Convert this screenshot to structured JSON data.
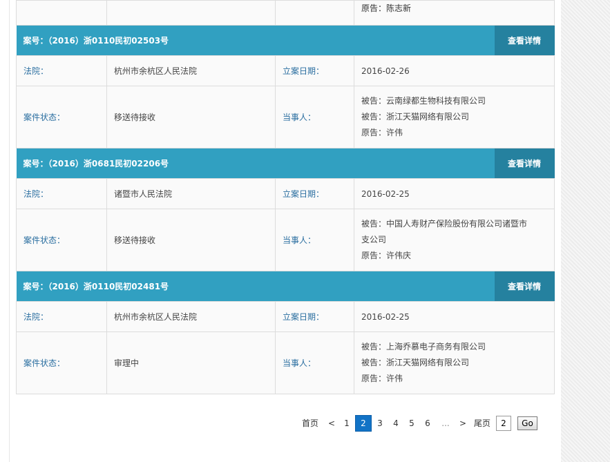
{
  "top_partial": {
    "parties": [
      "原告：陈志新"
    ]
  },
  "cases": [
    {
      "case_no": "案号：（2016）浙0110民初02503号",
      "detail_button": "查看详情",
      "court_label": "法院：",
      "court": "杭州市余杭区人民法院",
      "date_label": "立案日期：",
      "date": "2016-02-26",
      "status_label": "案件状态：",
      "status": "移送待接收",
      "parties_label": "当事人：",
      "parties": [
        "被告：云南绿都生物科技有限公司",
        "被告：浙江天猫网络有限公司",
        "原告：许伟"
      ]
    },
    {
      "case_no": "案号：（2016）浙0681民初02206号",
      "detail_button": "查看详情",
      "court_label": "法院：",
      "court": "诸暨市人民法院",
      "date_label": "立案日期：",
      "date": "2016-02-25",
      "status_label": "案件状态：",
      "status": "移送待接收",
      "parties_label": "当事人：",
      "parties": [
        "被告：中国人寿财产保险股份有限公司诸暨市",
        "支公司",
        "原告：许伟庆"
      ]
    },
    {
      "case_no": "案号：（2016）浙0110民初02481号",
      "detail_button": "查看详情",
      "court_label": "法院：",
      "court": "杭州市余杭区人民法院",
      "date_label": "立案日期：",
      "date": "2016-02-25",
      "status_label": "案件状态：",
      "status": "审理中",
      "parties_label": "当事人：",
      "parties": [
        "被告：上海乔慕电子商务有限公司",
        "被告：浙江天猫网络有限公司",
        "原告：许伟"
      ]
    }
  ],
  "pagination": {
    "first": "首页",
    "prev": "<",
    "pages": [
      "1",
      "2",
      "3",
      "4",
      "5",
      "6"
    ],
    "current": "2",
    "ellipsis": "...",
    "next": ">",
    "last": "尾页",
    "input_value": "2",
    "go": "Go"
  },
  "colors": {
    "header_bg": "#31a0c1",
    "detail_bg": "#25819f",
    "label_text": "#2a6ea0",
    "active_page": "#1273c6"
  }
}
